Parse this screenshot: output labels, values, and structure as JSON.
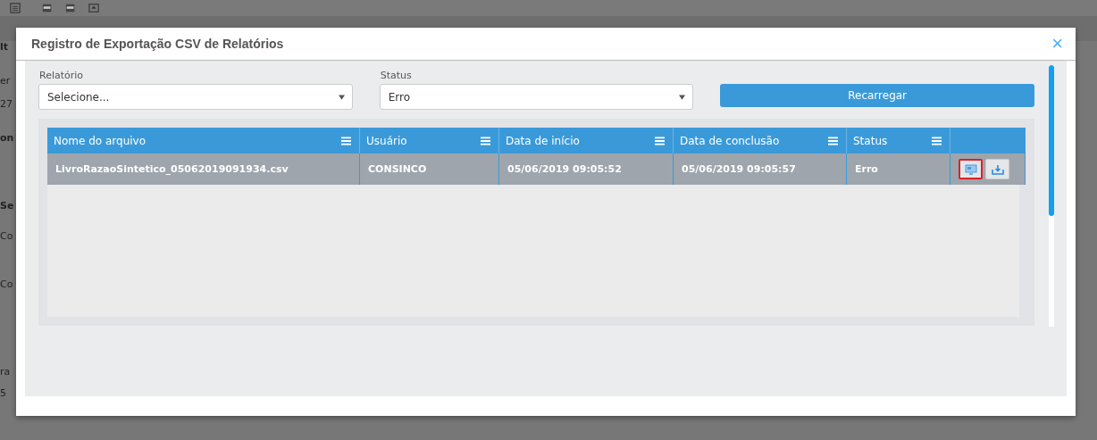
{
  "background_page": {
    "fragments": [
      "lt",
      "er",
      "27",
      "on",
      "Se",
      "Co",
      "Co",
      "ra",
      "5"
    ]
  },
  "dialog": {
    "title": "Registro de Exportação CSV de Relatórios",
    "close": "×"
  },
  "filters": [
    {
      "label": "Relatório",
      "value": "Selecione..."
    },
    {
      "label": "Status",
      "value": "Erro"
    }
  ],
  "reload_button": "Recarregar",
  "table": {
    "columns": [
      "Nome do arquivo",
      "Usuário",
      "Data de início",
      "Data de conclusão",
      "Status"
    ],
    "rows": [
      {
        "selected": true,
        "cells": [
          "LivroRazaoSintetico_05062019091934.csv",
          "CONSINCO",
          "05/06/2019 09:05:52",
          "05/06/2019 09:05:57",
          "Erro"
        ],
        "actions": [
          {
            "kind": "view",
            "highlighted": true
          },
          {
            "kind": "download",
            "highlighted": false
          }
        ]
      }
    ]
  }
}
